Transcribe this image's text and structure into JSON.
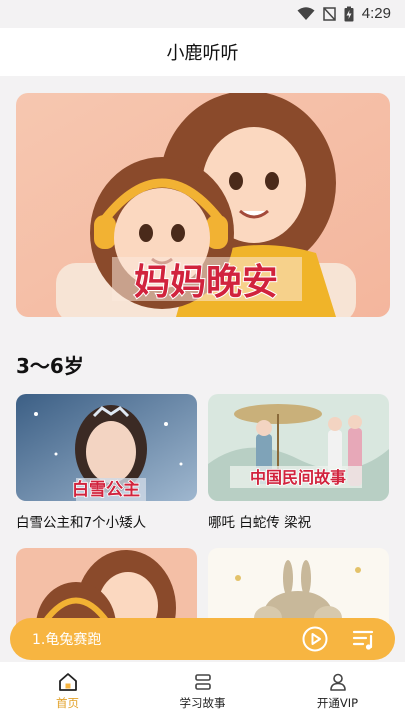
{
  "status_bar": {
    "time": "4:29",
    "icons": [
      "wifi-icon",
      "signal-off-icon",
      "battery-charging-icon"
    ]
  },
  "header": {
    "title": "小鹿听听"
  },
  "banner": {
    "overlay_text": "妈妈晚安"
  },
  "section": {
    "title": "3〜6岁"
  },
  "cards": [
    {
      "image_text": "白雪公主",
      "title": "白雪公主和7个小矮人"
    },
    {
      "image_text": "中国民间故事",
      "title": "哪吒 白蛇传 梁祝"
    }
  ],
  "player": {
    "track": "1.龟兔赛跑",
    "accent": "#f7b541"
  },
  "nav": {
    "items": [
      {
        "label": "首页",
        "icon": "home-icon",
        "active": true
      },
      {
        "label": "学习故事",
        "icon": "stack-icon",
        "active": false
      },
      {
        "label": "开通VIP",
        "icon": "user-icon",
        "active": false
      }
    ],
    "active_color": "#e2a22a"
  }
}
